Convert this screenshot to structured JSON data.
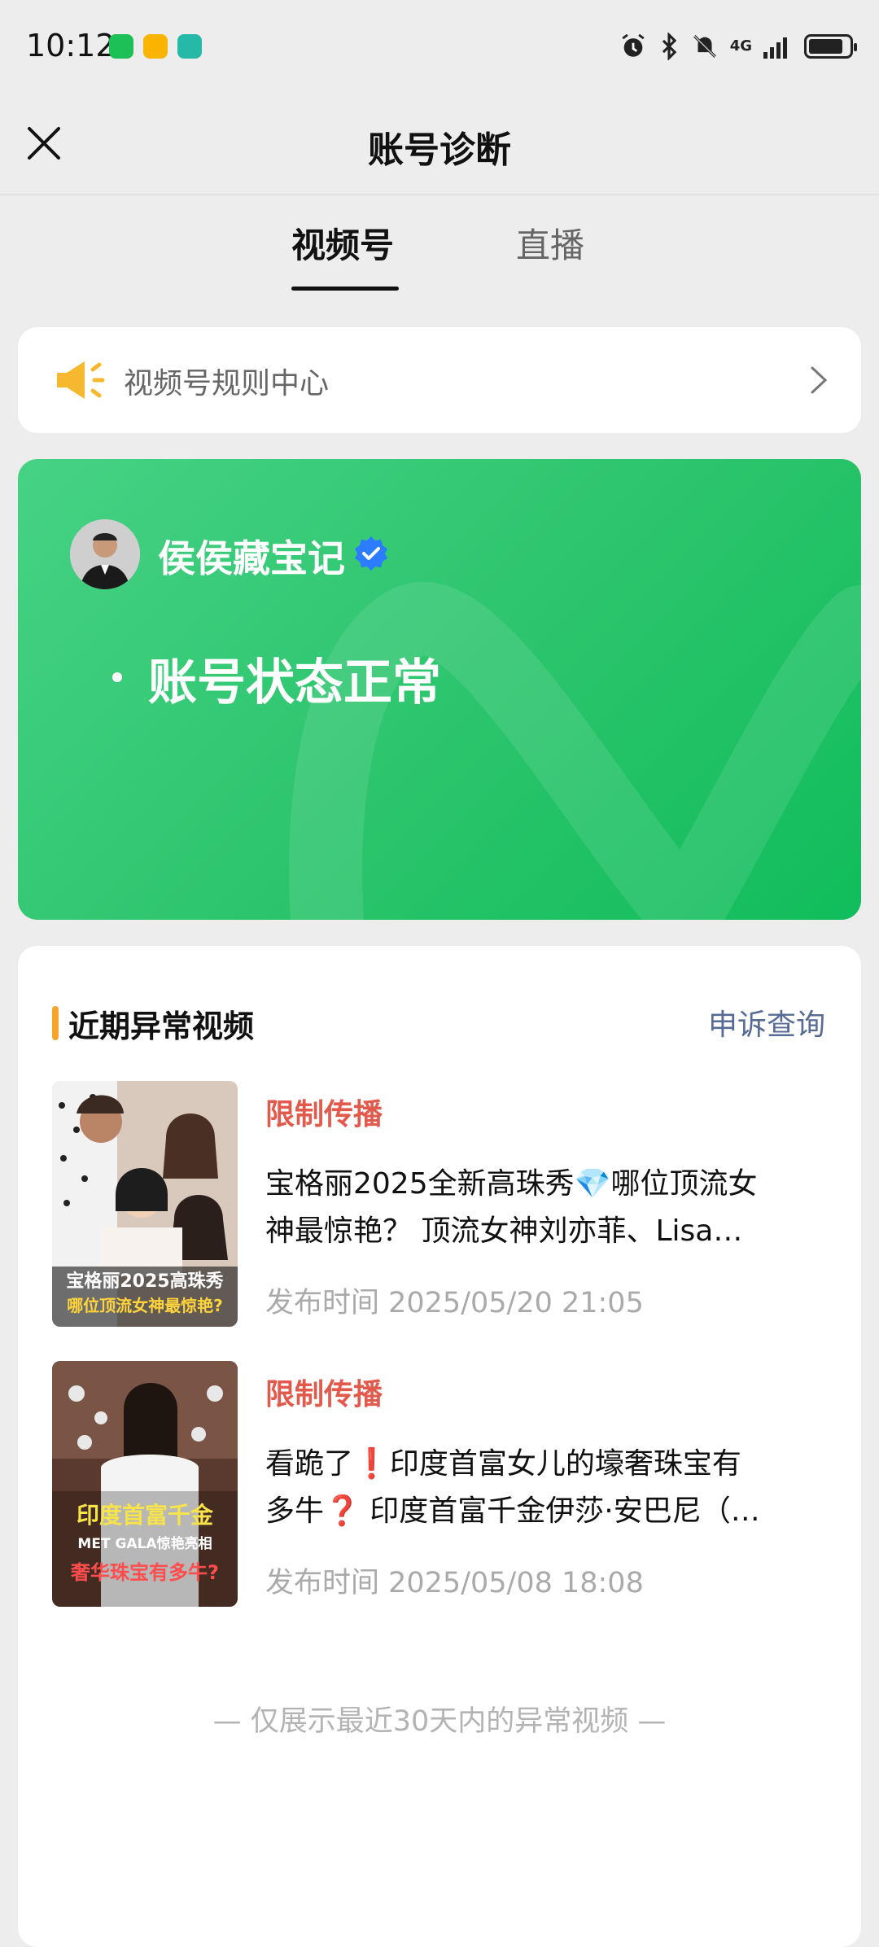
{
  "status_bar": {
    "time": "10:12",
    "network": "4G",
    "icons": [
      "wechat-notification-icon",
      "notification-icon",
      "app-notification-icon",
      "alarm-icon",
      "bluetooth-icon",
      "mute-icon",
      "signal-icon",
      "battery-icon"
    ]
  },
  "header": {
    "title": "账号诊断",
    "close_icon": "close-icon"
  },
  "tabs": [
    {
      "label": "视频号",
      "active": true
    },
    {
      "label": "直播",
      "active": false
    }
  ],
  "rule_center": {
    "label": "视频号规则中心",
    "icon": "megaphone-icon"
  },
  "account": {
    "name": "侯侯藏宝记",
    "verified": true,
    "status": "账号状态正常",
    "accent_color": "#2bc46c"
  },
  "abnormal_videos": {
    "title": "近期异常视频",
    "appeal_label": "申诉查询",
    "items": [
      {
        "status": "限制传播",
        "title_line1": "宝格丽2025全新高珠秀💎哪位顶流女",
        "title_line2": "神最惊艳？ 顶流女神刘亦菲、Lisa…",
        "publish_time": "发布时间 2025/05/20 21:05",
        "thumb_caption_line1": "宝格丽2025高珠秀",
        "thumb_caption_line2": "哪位顶流女神最惊艳?"
      },
      {
        "status": "限制传播",
        "title_line1": "看跪了❗印度首富女儿的壕奢珠宝有",
        "title_line2": "多牛❓ 印度首富千金伊莎·安巴尼（…",
        "publish_time": "发布时间 2025/05/08 18:08",
        "thumb_caption_line1": "印度首富千金",
        "thumb_caption_line2": "MET GALA惊艳亮相",
        "thumb_caption_line3": "奢华珠宝有多牛?"
      }
    ],
    "footer_note": "— 仅展示最近30天内的异常视频 —"
  },
  "colors": {
    "background": "#ededed",
    "restricted": "#e15a4c",
    "link": "#576b95",
    "section_accent": "#f6a42c"
  }
}
